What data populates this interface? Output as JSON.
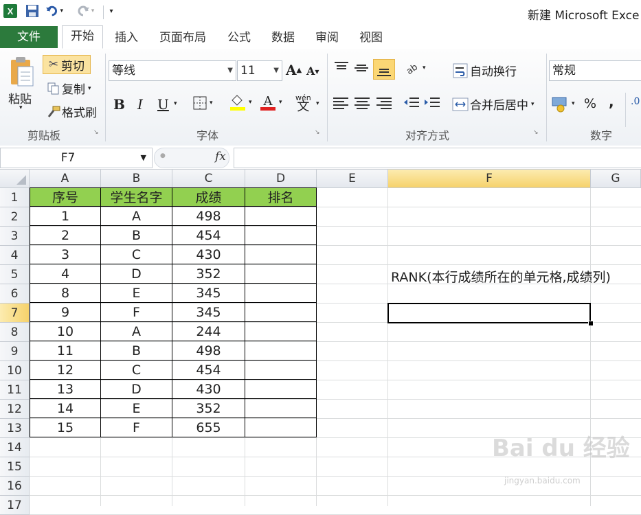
{
  "window": {
    "title": "新建 Microsoft Exce"
  },
  "quick_access": {
    "icons": [
      "excel-app-icon",
      "save-icon",
      "undo-icon",
      "redo-icon",
      "customize-qat-icon"
    ]
  },
  "tabs": [
    {
      "label": "文件"
    },
    {
      "label": "开始"
    },
    {
      "label": "插入"
    },
    {
      "label": "页面布局"
    },
    {
      "label": "公式"
    },
    {
      "label": "数据"
    },
    {
      "label": "审阅"
    },
    {
      "label": "视图"
    }
  ],
  "ribbon": {
    "clipboard": {
      "paste": "粘贴",
      "cut": "剪切",
      "copy": "复制",
      "format_painter": "格式刷",
      "label": "剪贴板"
    },
    "font": {
      "name": "等线",
      "size": "11",
      "bold": "B",
      "italic": "I",
      "underline": "U",
      "label": "字体",
      "phonetic": "wén",
      "phonetic_char": "文"
    },
    "alignment": {
      "wrap": "自动换行",
      "merge": "合并后居中",
      "label": "对齐方式"
    },
    "number": {
      "format": "常规",
      "percent": "%",
      "comma": ",",
      "label": "数字"
    }
  },
  "formula_bar": {
    "name_box": "F7",
    "fx": "fx",
    "content": ""
  },
  "grid": {
    "columns": [
      "A",
      "B",
      "C",
      "D",
      "E",
      "F",
      "G"
    ],
    "rows": [
      "1",
      "2",
      "3",
      "4",
      "5",
      "6",
      "7",
      "8",
      "9",
      "10",
      "11",
      "12",
      "13",
      "14",
      "15",
      "16",
      "17"
    ],
    "selected_column": "F",
    "selected_row": "7",
    "header": [
      "序号",
      "学生名字",
      "成绩",
      "排名"
    ],
    "data": [
      [
        "1",
        "A",
        "498",
        ""
      ],
      [
        "2",
        "B",
        "454",
        ""
      ],
      [
        "3",
        "C",
        "430",
        ""
      ],
      [
        "4",
        "D",
        "352",
        ""
      ],
      [
        "8",
        "E",
        "345",
        ""
      ],
      [
        "9",
        "F",
        "345",
        ""
      ],
      [
        "10",
        "A",
        "244",
        ""
      ],
      [
        "11",
        "B",
        "498",
        ""
      ],
      [
        "12",
        "C",
        "454",
        ""
      ],
      [
        "13",
        "D",
        "430",
        ""
      ],
      [
        "14",
        "E",
        "352",
        ""
      ],
      [
        "15",
        "F",
        "655",
        ""
      ]
    ],
    "note_cell": "RANK(本行成绩所在的单元格,成绩列)",
    "header_fill": "#92d050"
  },
  "watermark": {
    "main": "Bai du 经验",
    "sub": "jingyan.baidu.com"
  }
}
